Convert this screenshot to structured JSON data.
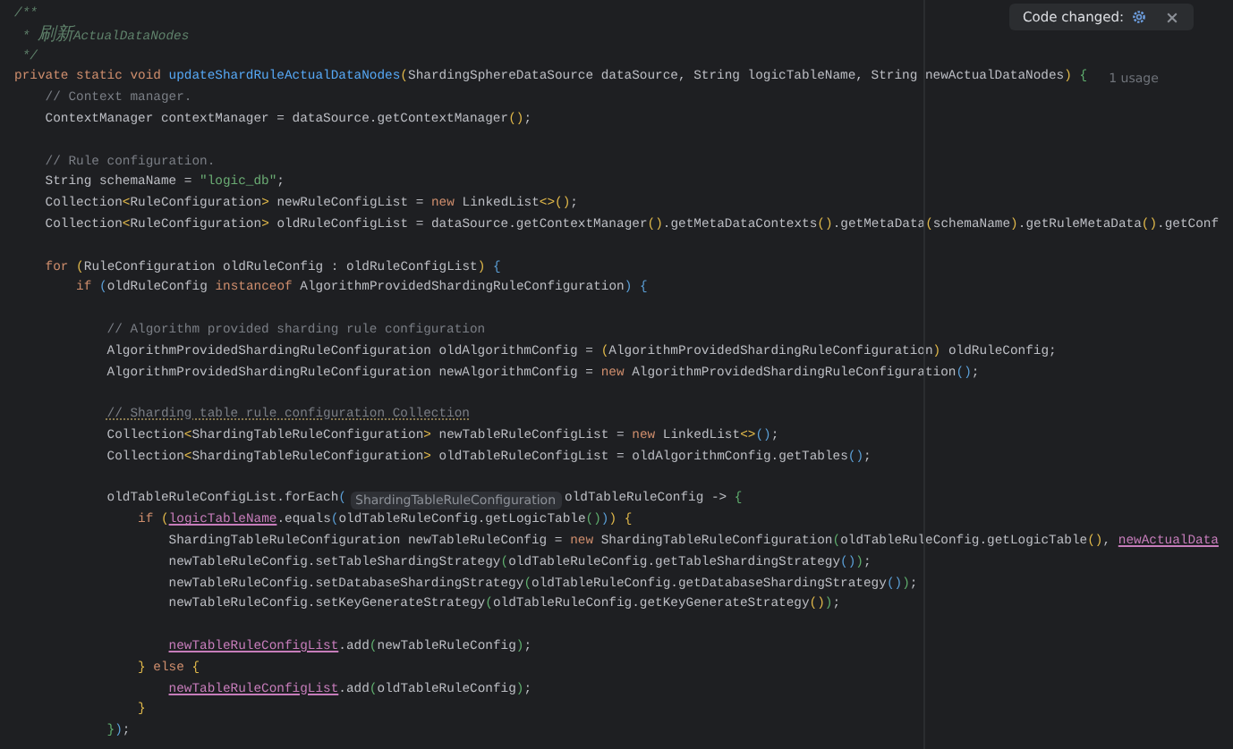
{
  "notification": {
    "text": "Code changed:"
  },
  "lines": [
    {
      "kind": "code",
      "parts": [
        {
          "kind": "code",
          "tokens": [
            {
              "kind": "doc",
              "text": "/**"
            }
          ]
        }
      ]
    },
    {
      "kind": "code",
      "parts": [
        {
          "kind": "code",
          "tokens": [
            {
              "kind": "doc",
              "text": " * "
            },
            {
              "kind": "cjkdoc",
              "text": "刷新"
            },
            {
              "kind": "doc",
              "text": "ActualDataNodes"
            }
          ]
        }
      ]
    },
    {
      "kind": "code",
      "parts": [
        {
          "kind": "code",
          "tokens": [
            {
              "kind": "doc",
              "text": " */"
            }
          ]
        }
      ]
    },
    {
      "kind": "code",
      "parts": [
        {
          "kind": "code",
          "tokens": [
            {
              "kind": "kw",
              "text": "private static void "
            },
            {
              "kind": "fn",
              "text": "updateShardRuleActualDataNodes"
            },
            {
              "kind": "paren1",
              "text": "("
            },
            {
              "kind": "txt",
              "text": "ShardingSphereDataSource dataSource, String logicTableName, String newActualDataNodes"
            },
            {
              "kind": "paren1",
              "text": ")"
            },
            {
              "kind": "paren3",
              "text": " {"
            }
          ]
        },
        {
          "kind": "usage",
          "text": "1 usage"
        }
      ]
    },
    {
      "kind": "code",
      "parts": [
        {
          "kind": "code",
          "tokens": [
            {
              "kind": "cmt",
              "text": "    // Context manager."
            }
          ]
        }
      ]
    },
    {
      "kind": "code",
      "parts": [
        {
          "kind": "code",
          "tokens": [
            {
              "kind": "txt",
              "text": "    ContextManager contextManager = dataSource.getContextManager"
            },
            {
              "kind": "paren1",
              "text": "()"
            },
            {
              "kind": "txt",
              "text": ";"
            }
          ]
        }
      ]
    },
    {
      "kind": "blank"
    },
    {
      "kind": "code",
      "parts": [
        {
          "kind": "code",
          "tokens": [
            {
              "kind": "cmt",
              "text": "    // Rule configuration."
            }
          ]
        }
      ]
    },
    {
      "kind": "code",
      "parts": [
        {
          "kind": "code",
          "tokens": [
            {
              "kind": "txt",
              "text": "    String schemaName = "
            },
            {
              "kind": "str",
              "text": "\"logic_db\""
            },
            {
              "kind": "txt",
              "text": ";"
            }
          ]
        }
      ]
    },
    {
      "kind": "code",
      "parts": [
        {
          "kind": "code",
          "tokens": [
            {
              "kind": "txt",
              "text": "    Collection"
            },
            {
              "kind": "paren1",
              "text": "<"
            },
            {
              "kind": "txt",
              "text": "RuleConfiguration"
            },
            {
              "kind": "paren1",
              "text": ">"
            },
            {
              "kind": "txt",
              "text": " newRuleConfigList = "
            },
            {
              "kind": "kw",
              "text": "new"
            },
            {
              "kind": "txt",
              "text": " LinkedList"
            },
            {
              "kind": "paren1",
              "text": "<>()"
            },
            {
              "kind": "txt",
              "text": ";"
            }
          ]
        }
      ]
    },
    {
      "kind": "code",
      "parts": [
        {
          "kind": "code",
          "tokens": [
            {
              "kind": "txt",
              "text": "    Collection"
            },
            {
              "kind": "paren1",
              "text": "<"
            },
            {
              "kind": "txt",
              "text": "RuleConfiguration"
            },
            {
              "kind": "paren1",
              "text": ">"
            },
            {
              "kind": "txt",
              "text": " oldRuleConfigList = dataSource.getContextManager"
            },
            {
              "kind": "paren1",
              "text": "()"
            },
            {
              "kind": "txt",
              "text": ".getMetaDataContexts"
            },
            {
              "kind": "paren1",
              "text": "()"
            },
            {
              "kind": "txt",
              "text": ".getMetaData"
            },
            {
              "kind": "paren1",
              "text": "("
            },
            {
              "kind": "txt",
              "text": "schemaName"
            },
            {
              "kind": "paren1",
              "text": ")"
            },
            {
              "kind": "txt",
              "text": ".getRuleMetaData"
            },
            {
              "kind": "paren1",
              "text": "()"
            },
            {
              "kind": "txt",
              "text": ".getConf"
            }
          ]
        }
      ]
    },
    {
      "kind": "blank"
    },
    {
      "kind": "code",
      "parts": [
        {
          "kind": "code",
          "tokens": [
            {
              "kind": "kw",
              "text": "    for"
            },
            {
              "kind": "paren1",
              "text": " ("
            },
            {
              "kind": "txt",
              "text": "RuleConfiguration oldRuleConfig : oldRuleConfigList"
            },
            {
              "kind": "paren1",
              "text": ")"
            },
            {
              "kind": "paren2",
              "text": " {"
            }
          ]
        }
      ]
    },
    {
      "kind": "code",
      "parts": [
        {
          "kind": "code",
          "tokens": [
            {
              "kind": "kw",
              "text": "        if"
            },
            {
              "kind": "paren2",
              "text": " ("
            },
            {
              "kind": "txt",
              "text": "oldRuleConfig "
            },
            {
              "kind": "kw",
              "text": "instanceof"
            },
            {
              "kind": "txt",
              "text": " AlgorithmProvidedShardingRuleConfiguration"
            },
            {
              "kind": "paren2",
              "text": ")"
            },
            {
              "kind": "paren2",
              "text": " {"
            }
          ]
        }
      ]
    },
    {
      "kind": "blank"
    },
    {
      "kind": "code",
      "parts": [
        {
          "kind": "code",
          "tokens": [
            {
              "kind": "cmt",
              "text": "            // Algorithm provided sharding rule configuration"
            }
          ]
        }
      ]
    },
    {
      "kind": "code",
      "parts": [
        {
          "kind": "code",
          "tokens": [
            {
              "kind": "txt",
              "text": "            AlgorithmProvidedShardingRuleConfiguration oldAlgorithmConfig = "
            },
            {
              "kind": "paren1",
              "text": "("
            },
            {
              "kind": "txt",
              "text": "AlgorithmProvidedShardingRuleConfiguration"
            },
            {
              "kind": "paren1",
              "text": ")"
            },
            {
              "kind": "txt",
              "text": " oldRuleConfig;"
            }
          ]
        }
      ]
    },
    {
      "kind": "code",
      "parts": [
        {
          "kind": "code",
          "tokens": [
            {
              "kind": "txt",
              "text": "            AlgorithmProvidedShardingRuleConfiguration newAlgorithmConfig = "
            },
            {
              "kind": "kw",
              "text": "new"
            },
            {
              "kind": "txt",
              "text": " AlgorithmProvidedShardingRuleConfiguration"
            },
            {
              "kind": "paren2",
              "text": "()"
            },
            {
              "kind": "txt",
              "text": ";"
            }
          ]
        }
      ]
    },
    {
      "kind": "blank"
    },
    {
      "kind": "code",
      "parts": [
        {
          "kind": "code",
          "tokens": [
            {
              "kind": "wcmt",
              "text": "            // Sharding table rule configuration Collection"
            }
          ]
        }
      ]
    },
    {
      "kind": "code",
      "parts": [
        {
          "kind": "code",
          "tokens": [
            {
              "kind": "txt",
              "text": "            Collection"
            },
            {
              "kind": "paren1",
              "text": "<"
            },
            {
              "kind": "txt",
              "text": "ShardingTableRuleConfiguration"
            },
            {
              "kind": "paren1",
              "text": ">"
            },
            {
              "kind": "txt",
              "text": " newTableRuleConfigList = "
            },
            {
              "kind": "kw",
              "text": "new"
            },
            {
              "kind": "txt",
              "text": " LinkedList"
            },
            {
              "kind": "paren1",
              "text": "<>"
            },
            {
              "kind": "paren2",
              "text": "()"
            },
            {
              "kind": "txt",
              "text": ";"
            }
          ]
        }
      ]
    },
    {
      "kind": "code",
      "parts": [
        {
          "kind": "code",
          "tokens": [
            {
              "kind": "txt",
              "text": "            Collection"
            },
            {
              "kind": "paren1",
              "text": "<"
            },
            {
              "kind": "txt",
              "text": "ShardingTableRuleConfiguration"
            },
            {
              "kind": "paren1",
              "text": ">"
            },
            {
              "kind": "txt",
              "text": " oldTableRuleConfigList = oldAlgorithmConfig.getTables"
            },
            {
              "kind": "paren2",
              "text": "()"
            },
            {
              "kind": "txt",
              "text": ";"
            }
          ]
        }
      ]
    },
    {
      "kind": "blank"
    },
    {
      "kind": "code",
      "parts": [
        {
          "kind": "code",
          "tokens": [
            {
              "kind": "txt",
              "text": "            oldTableRuleConfigList.forEach"
            },
            {
              "kind": "paren2",
              "text": "("
            }
          ]
        },
        {
          "kind": "inlay",
          "text": "ShardingTableRuleConfiguration"
        },
        {
          "kind": "code",
          "tokens": [
            {
              "kind": "txt",
              "text": "oldTableRuleConfig -> "
            },
            {
              "kind": "paren3",
              "text": "{"
            }
          ]
        }
      ]
    },
    {
      "kind": "code",
      "parts": [
        {
          "kind": "code",
          "tokens": [
            {
              "kind": "kw",
              "text": "                if"
            },
            {
              "kind": "paren1",
              "text": " ("
            },
            {
              "kind": "cap",
              "text": "logicTableName"
            },
            {
              "kind": "txt",
              "text": ".equals"
            },
            {
              "kind": "paren2",
              "text": "("
            },
            {
              "kind": "txt",
              "text": "oldTableRuleConfig.getLogicTable"
            },
            {
              "kind": "paren3",
              "text": "()"
            },
            {
              "kind": "paren2",
              "text": ")"
            },
            {
              "kind": "paren1",
              "text": ")"
            },
            {
              "kind": "paren1",
              "text": " {"
            }
          ]
        }
      ]
    },
    {
      "kind": "code",
      "parts": [
        {
          "kind": "code",
          "tokens": [
            {
              "kind": "txt",
              "text": "                    ShardingTableRuleConfiguration newTableRuleConfig = "
            },
            {
              "kind": "kw",
              "text": "new"
            },
            {
              "kind": "txt",
              "text": " ShardingTableRuleConfiguration"
            },
            {
              "kind": "paren3",
              "text": "("
            },
            {
              "kind": "txt",
              "text": "oldTableRuleConfig.getLogicTable"
            },
            {
              "kind": "paren1",
              "text": "()"
            },
            {
              "kind": "txt",
              "text": ", "
            },
            {
              "kind": "cap",
              "text": "newActualData"
            }
          ]
        }
      ]
    },
    {
      "kind": "code",
      "parts": [
        {
          "kind": "code",
          "tokens": [
            {
              "kind": "txt",
              "text": "                    newTableRuleConfig.setTableShardingStrategy"
            },
            {
              "kind": "paren3",
              "text": "("
            },
            {
              "kind": "txt",
              "text": "oldTableRuleConfig.getTableShardingStrategy"
            },
            {
              "kind": "paren2",
              "text": "()"
            },
            {
              "kind": "paren3",
              "text": ")"
            },
            {
              "kind": "txt",
              "text": ";"
            }
          ]
        }
      ]
    },
    {
      "kind": "code",
      "parts": [
        {
          "kind": "code",
          "tokens": [
            {
              "kind": "txt",
              "text": "                    newTableRuleConfig.setDatabaseShardingStrategy"
            },
            {
              "kind": "paren3",
              "text": "("
            },
            {
              "kind": "txt",
              "text": "oldTableRuleConfig.getDatabaseShardingStrategy"
            },
            {
              "kind": "paren2",
              "text": "()"
            },
            {
              "kind": "paren3",
              "text": ")"
            },
            {
              "kind": "txt",
              "text": ";"
            }
          ]
        }
      ]
    },
    {
      "kind": "code",
      "parts": [
        {
          "kind": "code",
          "tokens": [
            {
              "kind": "txt",
              "text": "                    newTableRuleConfig.setKeyGenerateStrategy"
            },
            {
              "kind": "paren3",
              "text": "("
            },
            {
              "kind": "txt",
              "text": "oldTableRuleConfig.getKeyGenerateStrategy"
            },
            {
              "kind": "paren1",
              "text": "()"
            },
            {
              "kind": "paren3",
              "text": ")"
            },
            {
              "kind": "txt",
              "text": ";"
            }
          ]
        }
      ]
    },
    {
      "kind": "blank"
    },
    {
      "kind": "code",
      "parts": [
        {
          "kind": "code",
          "tokens": [
            {
              "kind": "cap",
              "text": "                    newTableRuleConfigList"
            },
            {
              "kind": "txt",
              "text": ".add"
            },
            {
              "kind": "paren3",
              "text": "("
            },
            {
              "kind": "txt",
              "text": "newTableRuleConfig"
            },
            {
              "kind": "paren3",
              "text": ")"
            },
            {
              "kind": "txt",
              "text": ";"
            }
          ]
        }
      ]
    },
    {
      "kind": "code",
      "parts": [
        {
          "kind": "code",
          "tokens": [
            {
              "kind": "paren1",
              "text": "                }"
            },
            {
              "kind": "kw",
              "text": " else"
            },
            {
              "kind": "paren1",
              "text": " {"
            }
          ]
        }
      ]
    },
    {
      "kind": "code",
      "parts": [
        {
          "kind": "code",
          "tokens": [
            {
              "kind": "cap",
              "text": "                    newTableRuleConfigList"
            },
            {
              "kind": "txt",
              "text": ".add"
            },
            {
              "kind": "paren3",
              "text": "("
            },
            {
              "kind": "txt",
              "text": "oldTableRuleConfig"
            },
            {
              "kind": "paren3",
              "text": ")"
            },
            {
              "kind": "txt",
              "text": ";"
            }
          ]
        }
      ]
    },
    {
      "kind": "code",
      "parts": [
        {
          "kind": "code",
          "tokens": [
            {
              "kind": "paren1",
              "text": "                }"
            }
          ]
        }
      ]
    },
    {
      "kind": "code",
      "parts": [
        {
          "kind": "code",
          "tokens": [
            {
              "kind": "paren3",
              "text": "            }"
            },
            {
              "kind": "paren2",
              "text": ")"
            },
            {
              "kind": "txt",
              "text": ";"
            }
          ]
        }
      ]
    }
  ]
}
